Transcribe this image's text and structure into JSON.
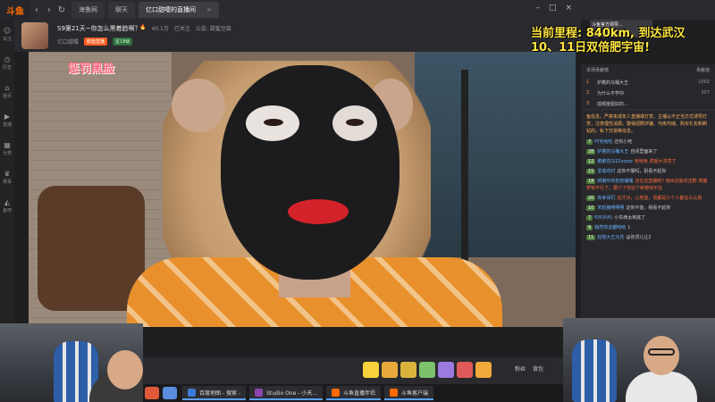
{
  "app": {
    "logo": "斗鱼"
  },
  "tabs": [
    {
      "label": "海鲁网",
      "active": false
    },
    {
      "label": "聊天",
      "active": false
    },
    {
      "label": "亿口甜嘤的直播间",
      "active": true
    }
  ],
  "rail": [
    {
      "icon": "user-icon",
      "label": "关注"
    },
    {
      "icon": "history-icon",
      "label": "历史"
    },
    {
      "icon": "home-icon",
      "label": "首页"
    },
    {
      "icon": "live-icon",
      "label": "直播"
    },
    {
      "icon": "category-icon",
      "label": "分类"
    },
    {
      "icon": "match-icon",
      "label": "赛事"
    },
    {
      "icon": "fish-icon",
      "label": "鱼吧"
    }
  ],
  "room": {
    "title": "S9第21天~你怎么黑着脸啊？",
    "streamer": "亿口甜嘤",
    "tag": "颜值直播",
    "level_badge": "星18级",
    "hot": "40.1万",
    "followers": "已关注",
    "guild": "公会: 甜蜜豆腐"
  },
  "video": {
    "caption": "惩罚黑脸",
    "top_overlay_line1": "当前里程: 840km, 到达武汉",
    "top_overlay_line2": "10、11日双倍肥宇宙!"
  },
  "notice": {
    "text": "斗鱼官方领导..."
  },
  "rank": {
    "header_left": "本场贡献榜",
    "header_right": "贡献值",
    "rows": [
      {
        "num": "1",
        "name": "护着的马桶大王",
        "score": "1002"
      },
      {
        "num": "2",
        "name": "为什么不学你",
        "score": "307"
      },
      {
        "num": "3",
        "name": "成频度挺好的...",
        "score": ""
      }
    ]
  },
  "announce": "鱼信息。严禁未成年人直播或打赏。主播以不正当方式诱导打赏，注意理性消费。警惕招聘诈骗、代练代储、购买礼包和刷钻的，私下交易等信息。",
  "chat": [
    {
      "name": "叼毛哈哈",
      "lv": "7",
      "text": "还有小死"
    },
    {
      "name": "护着的马桶大王",
      "lv": "28",
      "text": "自闭里面来了"
    },
    {
      "name": "鹅鹅花马22zzzzz",
      "lv": "12",
      "text": "哈哈哈 虎姐大漂亮了"
    },
    {
      "name": "爱偷鸡村",
      "lv": "15",
      "text": "这你不服吗，别看不起你"
    },
    {
      "name": "鲜嫩中的奶奶嘴嘴",
      "lv": "18",
      "text": "还在这直播呢? 她出这股攻击群 熊猫梦铁不行了，要少了你这个新爬线不住"
    },
    {
      "name": "有考哥们",
      "lv": "20",
      "text": "这才对，心地善，而都是小个人都这么认真"
    },
    {
      "name": "宋粒猪啊啊啊",
      "lv": "10",
      "text": "这你不能，我看不起你"
    },
    {
      "name": "叭叭叭叭",
      "lv": "7",
      "text": "小东西太到底了"
    },
    {
      "name": "貌然你这都哈哈",
      "lv": "9",
      "text": "1"
    },
    {
      "name": "赵桂大王元花",
      "lv": "11",
      "text": "@张顶儿让2"
    }
  ],
  "gift_bar": {
    "label_fans": "粉丝",
    "label_bag": "背包"
  },
  "taskbar": [
    {
      "label": "百度地图 - 搜索 -",
      "color": "#3a7bd5"
    },
    {
      "label": "Studio One - 小天...",
      "color": "#8e44ad"
    },
    {
      "label": "斗鱼直播伴侣",
      "color": "#ff6a00"
    },
    {
      "label": "斗鱼客户端",
      "color": "#ff6a00"
    }
  ]
}
